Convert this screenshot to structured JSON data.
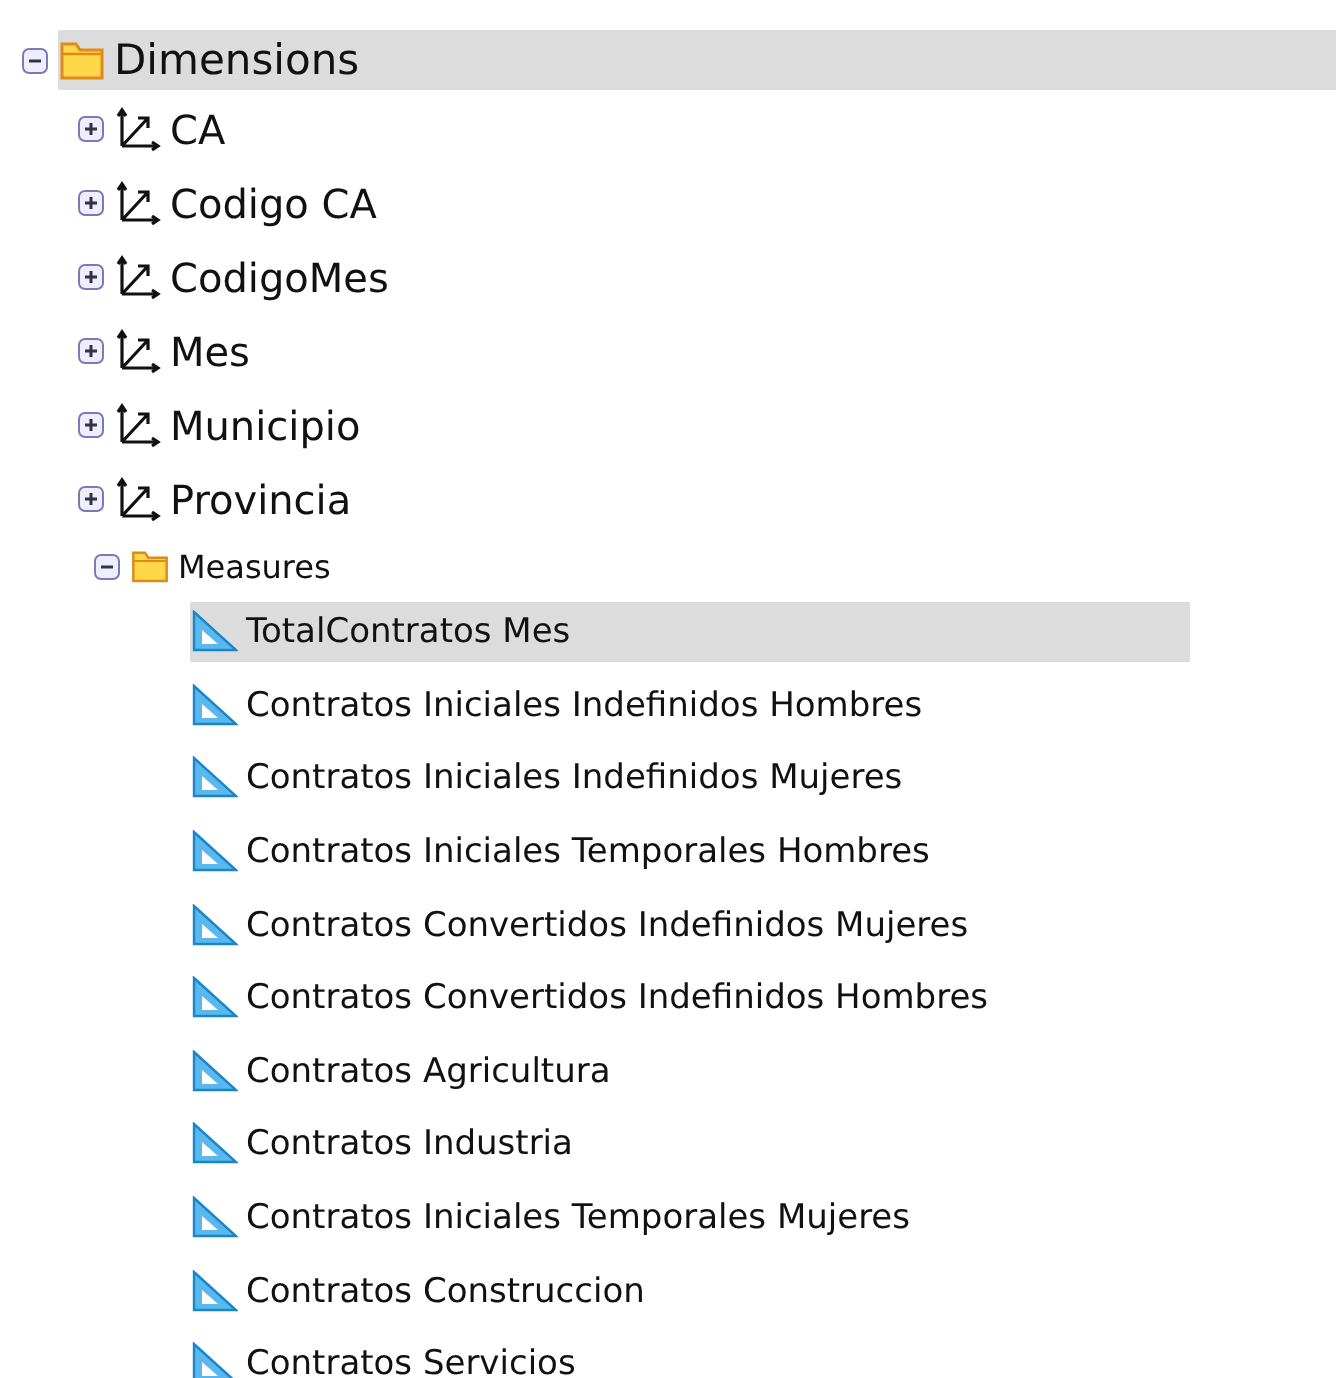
{
  "tree": [
    {
      "kind": "folder",
      "label": "Dimensions",
      "expanded": true,
      "selected": true,
      "children": [
        {
          "kind": "dimension",
          "label": "CA",
          "expanded": false,
          "selected": false
        },
        {
          "kind": "dimension",
          "label": "Codigo CA",
          "expanded": false,
          "selected": false
        },
        {
          "kind": "dimension",
          "label": "CodigoMes",
          "expanded": false,
          "selected": false
        },
        {
          "kind": "dimension",
          "label": "Mes",
          "expanded": false,
          "selected": false
        },
        {
          "kind": "dimension",
          "label": "Municipio",
          "expanded": false,
          "selected": false
        },
        {
          "kind": "dimension",
          "label": "Provincia",
          "expanded": false,
          "selected": false
        },
        {
          "kind": "subfolder",
          "label": "Measures",
          "expanded": true,
          "selected": false,
          "children": [
            {
              "kind": "measure",
              "label": "TotalContratos Mes",
              "selected": true
            },
            {
              "kind": "measure",
              "label": "Contratos Iniciales Indefinidos Hombres",
              "selected": false
            },
            {
              "kind": "measure",
              "label": "Contratos Iniciales Indefinidos Mujeres",
              "selected": false
            },
            {
              "kind": "measure",
              "label": "Contratos Iniciales Temporales Hombres",
              "selected": false
            },
            {
              "kind": "measure",
              "label": "Contratos Convertidos Indefinidos Mujeres",
              "selected": false
            },
            {
              "kind": "measure",
              "label": "Contratos Convertidos Indefinidos Hombres",
              "selected": false
            },
            {
              "kind": "measure",
              "label": "Contratos Agricultura",
              "selected": false
            },
            {
              "kind": "measure",
              "label": "Contratos Industria",
              "selected": false
            },
            {
              "kind": "measure",
              "label": "Contratos Iniciales Temporales Mujeres",
              "selected": false
            },
            {
              "kind": "measure",
              "label": "Contratos Construccion",
              "selected": false
            },
            {
              "kind": "measure",
              "label": "Contratos Servicios",
              "selected": false
            }
          ]
        }
      ]
    }
  ]
}
